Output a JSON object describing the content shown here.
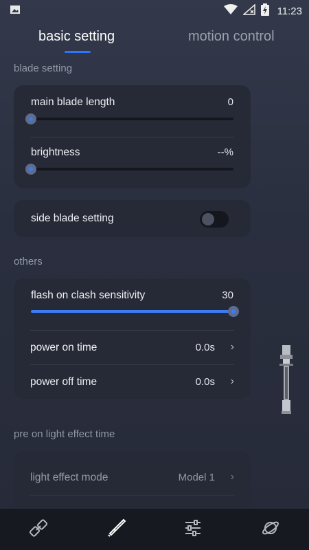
{
  "status_bar": {
    "time": "11:23"
  },
  "tabs": {
    "basic": "basic setting",
    "motion": "motion control"
  },
  "blade_setting": {
    "label": "blade setting",
    "main_length": {
      "title": "main blade length",
      "value": "0",
      "level": 0
    },
    "brightness": {
      "title": "brightness",
      "value": "--%",
      "level": 0
    }
  },
  "side_blade": {
    "title": "side blade setting",
    "enabled": false
  },
  "others": {
    "label": "others",
    "clash": {
      "title": "flash on clash sensitivity",
      "value": "30",
      "level": 1.0
    },
    "power_on": {
      "title": "power on time",
      "value": "0.0s"
    },
    "power_off": {
      "title": "power off time",
      "value": "0.0s"
    }
  },
  "pre_on": {
    "label": "pre on light effect time",
    "mode": {
      "title": "light effect mode",
      "value": "Model 1"
    }
  },
  "icons": {
    "nav": [
      "link-icon",
      "saber-icon",
      "sliders-icon",
      "planet-icon"
    ],
    "active_nav": "saber-icon"
  },
  "colors": {
    "accent": "#2f74ff",
    "background": "#2a2f3f",
    "card": "#262a36",
    "nav": "#171920"
  }
}
